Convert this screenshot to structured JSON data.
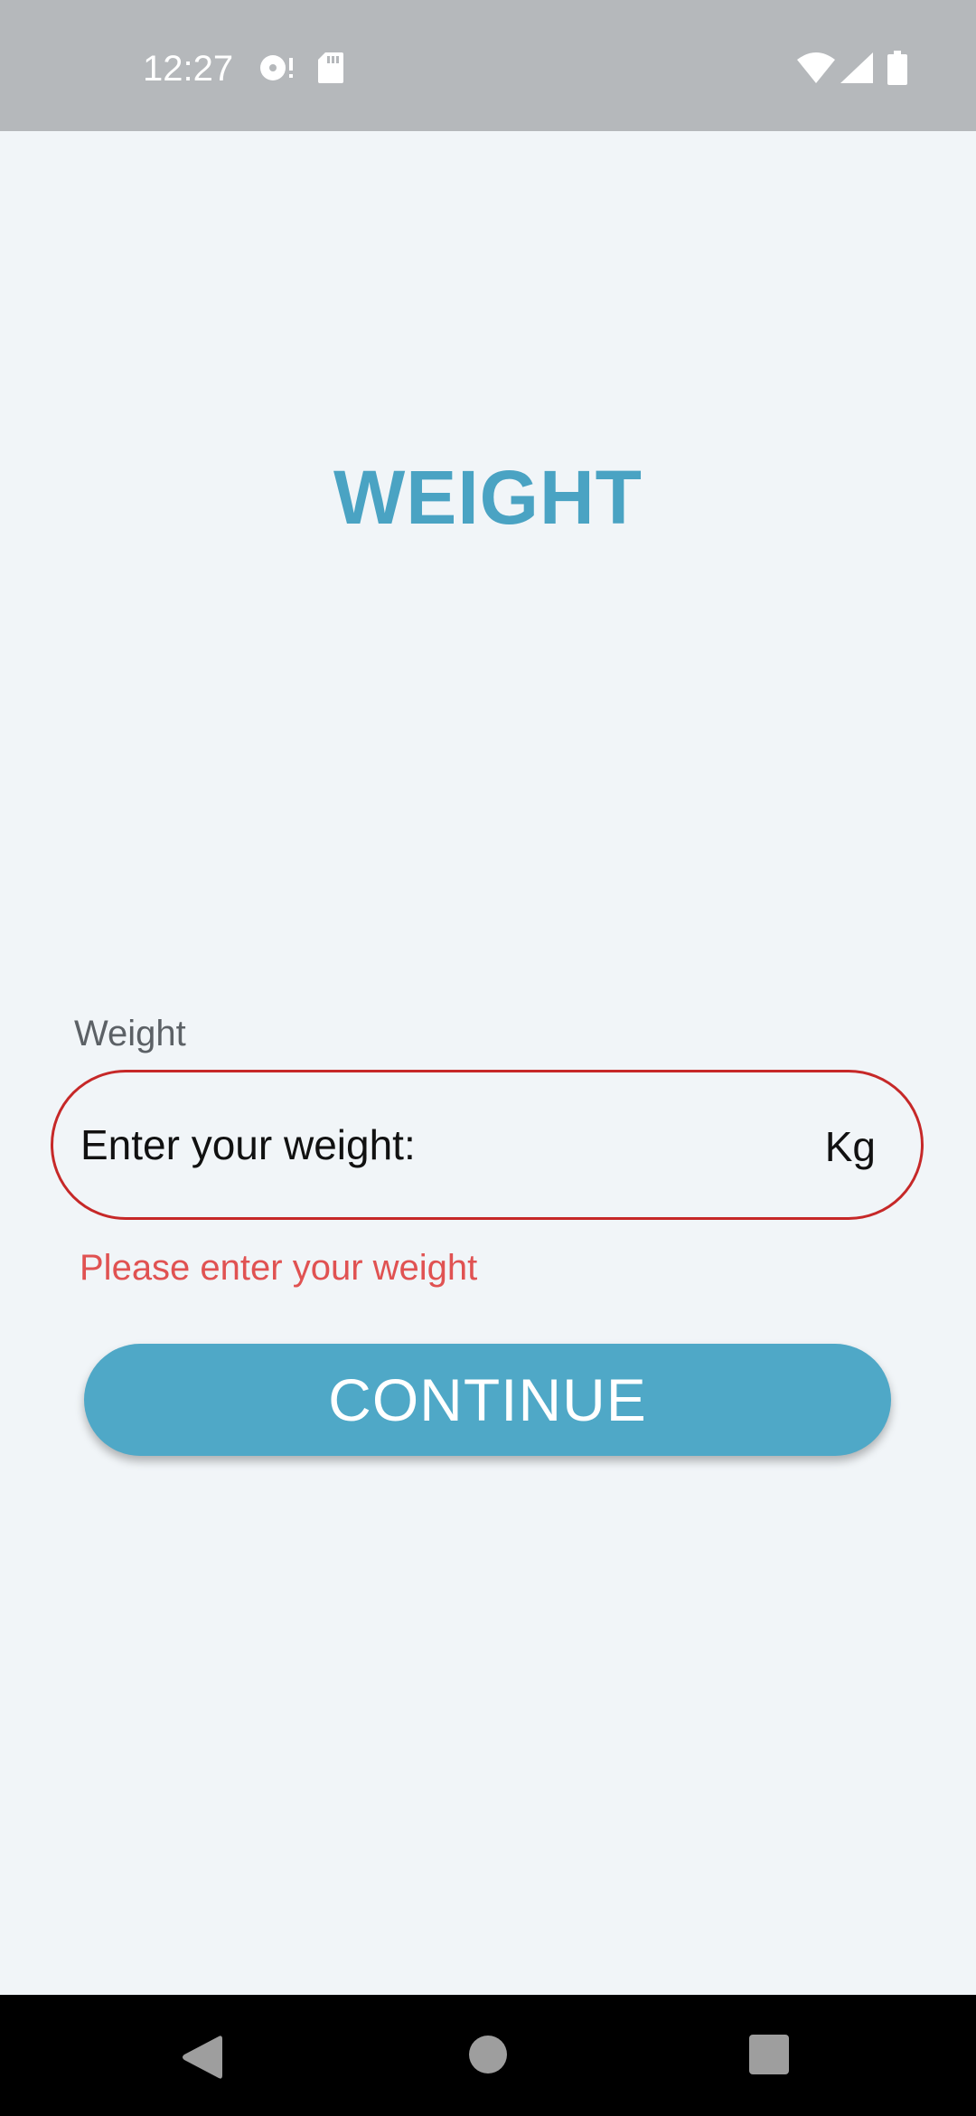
{
  "status_bar": {
    "time": "12:27",
    "icons": [
      "dnd-icon",
      "sd-card-icon",
      "wifi-icon",
      "signal-icon",
      "battery-icon"
    ]
  },
  "screen": {
    "title": "WEIGHT"
  },
  "weight_field": {
    "label": "Weight",
    "placeholder": "Enter your weight:",
    "value": "",
    "unit": "Kg",
    "error": "Please enter your weight"
  },
  "actions": {
    "continue_label": "CONTINUE"
  },
  "nav_bar": {
    "icons": [
      "back-icon",
      "home-icon",
      "recents-icon"
    ]
  },
  "colors": {
    "accent": "#4fa8c7",
    "title": "#4aa3c3",
    "error": "#e05252",
    "error_border": "#c62828",
    "background": "#f1f5f8",
    "status_bar": "#b5b8bb"
  }
}
